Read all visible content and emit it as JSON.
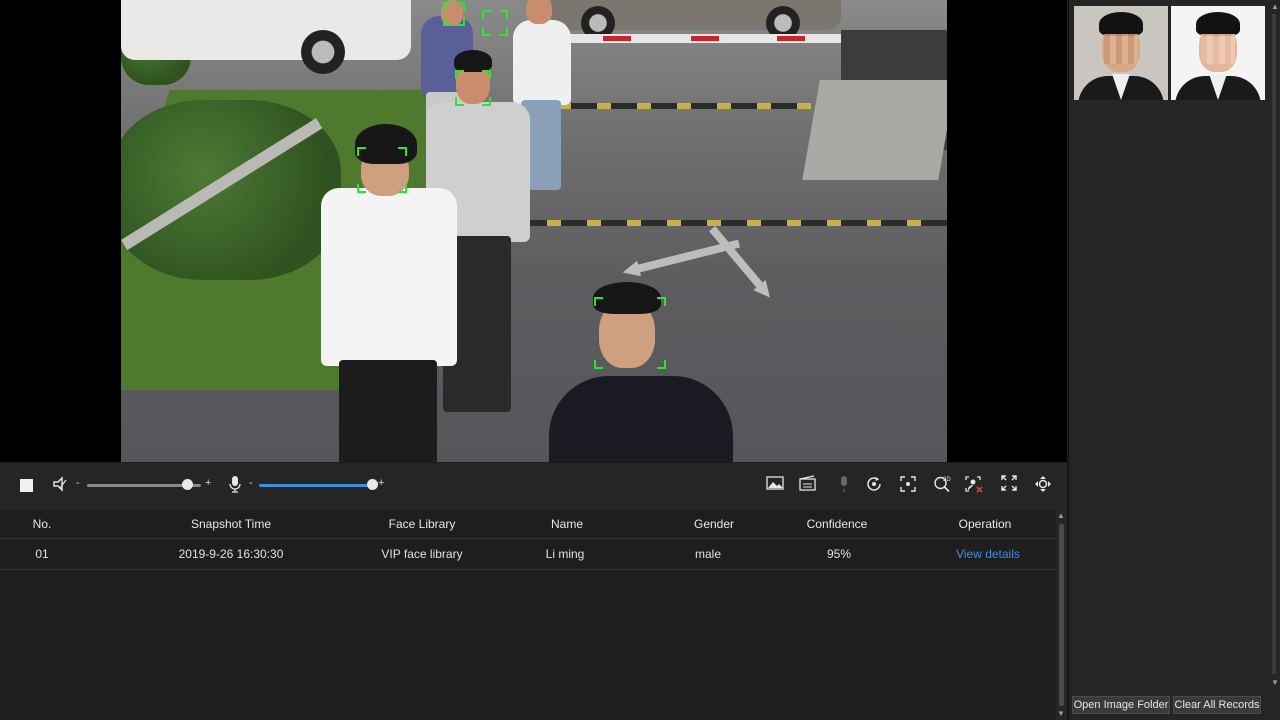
{
  "toolbar": {
    "stop": "stop-icon",
    "speaker": "speaker-icon",
    "mic": "microphone-icon",
    "minus": "-",
    "plus": "+",
    "speaker_volume": 0.88,
    "mic_volume": 1.0,
    "slider_accent": "#3d8fe0",
    "right_icons": [
      "snapshot-icon",
      "record-icon",
      "talk-icon",
      "rotate-icon",
      "focus-icon",
      "zoom-3d-icon",
      "face-alarm-icon",
      "fullscreen-icon",
      "ptz-icon"
    ]
  },
  "table": {
    "headers": {
      "no": "No.",
      "snapshot_time": "Snapshot Time",
      "face_library": "Face Library",
      "name": "Name",
      "gender": "Gender",
      "confidence": "Confidence",
      "operation": "Operation"
    },
    "rows": [
      {
        "no": "01",
        "snapshot_time": "2019-9-26 16:30:30",
        "face_library": "VIP face library",
        "name": "Li ming",
        "gender": "male",
        "confidence": "95%",
        "operation": "View details"
      }
    ]
  },
  "side": {
    "open_folder": "Open Image Folder",
    "clear_records": "Clear All Records"
  },
  "colors": {
    "detection_box": "#2ee52e",
    "link": "#3d8fe0",
    "panel_bg": "#252526"
  }
}
